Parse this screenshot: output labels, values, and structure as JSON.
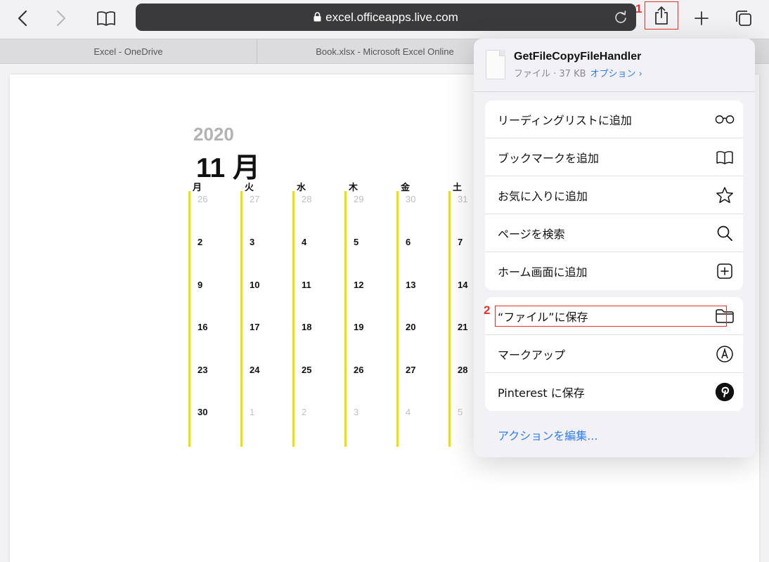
{
  "browser": {
    "url": "excel.officeapps.live.com",
    "tabs": [
      "Excel - OneDrive",
      "Book.xlsx - Microsoft Excel Online"
    ]
  },
  "annotations": {
    "step1": "1",
    "step2": "2"
  },
  "calendar": {
    "year": "2020",
    "month": "11 月",
    "day_headers": [
      "月",
      "火",
      "水",
      "木",
      "金",
      "土"
    ],
    "weeks": [
      [
        "26",
        "27",
        "28",
        "29",
        "30",
        "31"
      ],
      [
        "2",
        "3",
        "4",
        "5",
        "6",
        "7"
      ],
      [
        "9",
        "10",
        "11",
        "12",
        "13",
        "14"
      ],
      [
        "16",
        "17",
        "18",
        "19",
        "20",
        "21"
      ],
      [
        "23",
        "24",
        "25",
        "26",
        "27",
        "28"
      ],
      [
        "30",
        "1",
        "2",
        "3",
        "4",
        "5"
      ]
    ]
  },
  "share_sheet": {
    "file_name": "GetFileCopyFileHandler",
    "file_meta": "ファイル · 37 KB",
    "options_link": "オプション ›",
    "group1": [
      {
        "label": "リーディングリストに追加",
        "icon": "glasses-icon"
      },
      {
        "label": "ブックマークを追加",
        "icon": "book-icon"
      },
      {
        "label": "お気に入りに追加",
        "icon": "star-icon"
      },
      {
        "label": "ページを検索",
        "icon": "search-icon"
      },
      {
        "label": "ホーム画面に追加",
        "icon": "plus-square-icon"
      }
    ],
    "group2": [
      {
        "label": "“ファイル”に保存",
        "icon": "folder-icon"
      },
      {
        "label": "マークアップ",
        "icon": "markup-icon"
      },
      {
        "label": "Pinterest に保存",
        "icon": "pinterest-icon"
      }
    ],
    "edit_actions": "アクションを編集..."
  },
  "colors": {
    "accent": "#2f7cf6",
    "annotation": "#e6302b",
    "calendar_bar": "#f0e000"
  }
}
